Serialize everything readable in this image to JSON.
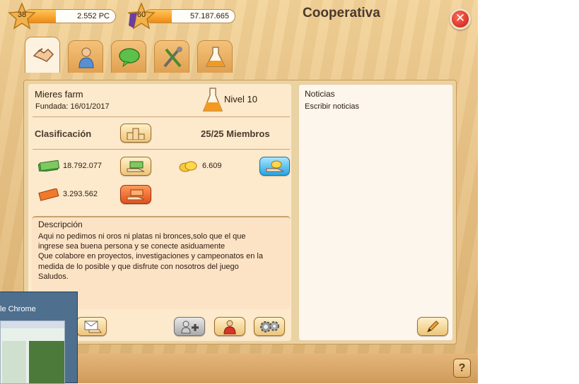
{
  "player": {
    "level": "38",
    "pc": "2.552 PC",
    "xp_progress": 0.35
  },
  "coop": {
    "level": "60",
    "points": "57.187.665",
    "points_progress": 0.3
  },
  "window": {
    "title": "Cooperativa",
    "close_symbol": "✕"
  },
  "tabs": [
    {
      "name": "cooperative-icon",
      "active": true
    },
    {
      "name": "members-icon",
      "active": false
    },
    {
      "name": "chat-icon",
      "active": false
    },
    {
      "name": "tools-icon",
      "active": false
    },
    {
      "name": "research-flask-icon",
      "active": false
    }
  ],
  "farm": {
    "name": "Mieres farm",
    "founded": "Fundada: 16/01/2017",
    "level": "Nivel 10",
    "ranking_label": "Clasificación",
    "members": "25/25 Miembros",
    "cash": "18.792.077",
    "coins": "6.609",
    "tickets": "3.293.562"
  },
  "description": {
    "heading": "Descripción",
    "lines": [
      "Aqui no pedimos ni oros ni platas ni bronces,solo que el que",
      "ingrese sea buena persona y se conecte asiduamente",
      "Que colabore en proyectos, investigaciones y campeonatos en la",
      "medida de lo posible y que disfrute con nosotros del juego",
      "Saludos."
    ]
  },
  "news": {
    "heading": "Noticias",
    "placeholder": "Escribir noticias"
  },
  "help_symbol": "?",
  "taskbar_popup": {
    "title": "le Chrome"
  },
  "colors": {
    "accent_orange": "#f08a12",
    "panel": "#ead3a2",
    "close_red": "#c41a10"
  }
}
